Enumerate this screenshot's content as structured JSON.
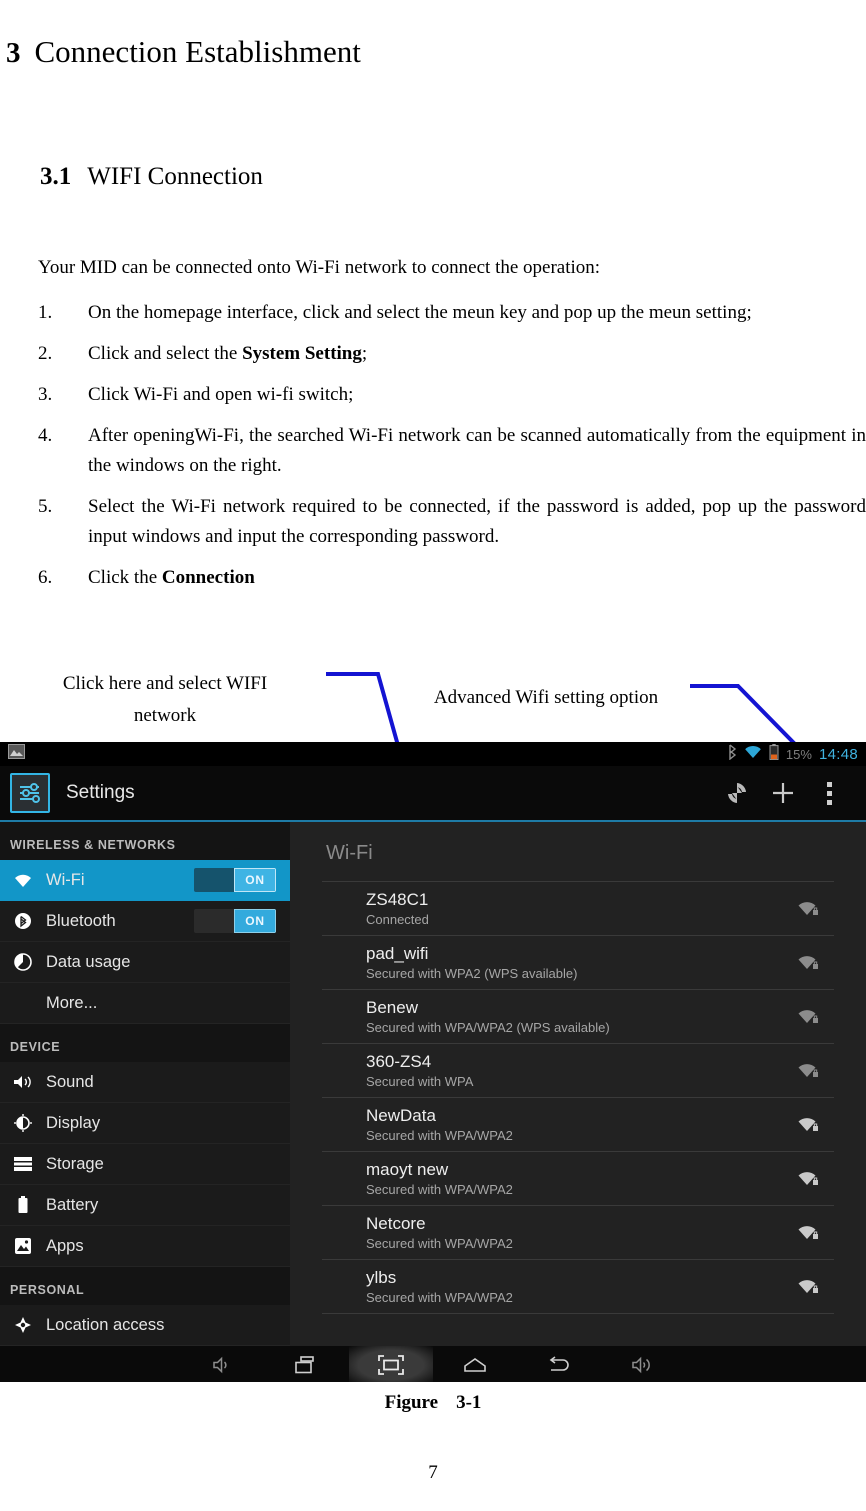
{
  "document": {
    "chapter": {
      "number": "3",
      "title": "Connection Establishment"
    },
    "section": {
      "number": "3.1",
      "title": "WIFI Connection"
    },
    "intro": "Your MID can be connected onto Wi-Fi network to connect the operation:",
    "steps": [
      {
        "marker": "1.",
        "text_before": "On the homepage interface, click and select the meun key and pop up the meun setting;",
        "bold": "",
        "text_after": ""
      },
      {
        "marker": "2.",
        "text_before": "Click and select the ",
        "bold": "System Setting",
        "text_after": ";"
      },
      {
        "marker": "3.",
        "text_before": "Click Wi-Fi and open wi-fi switch;",
        "bold": "",
        "text_after": ""
      },
      {
        "marker": "4.",
        "text_before": "After openingWi-Fi, the searched Wi-Fi network can be scanned automatically from the equipment in the windows on the right.",
        "bold": "",
        "text_after": ""
      },
      {
        "marker": "5.",
        "text_before": "Select the Wi-Fi network required to be connected, if the password is added, pop up the password input windows and input the corresponding password.",
        "bold": "",
        "text_after": ""
      },
      {
        "marker": "6.",
        "text_before": "Click the ",
        "bold": "Connection",
        "text_after": ""
      }
    ],
    "figure_caption": {
      "label": "Figure",
      "number": "3-1"
    },
    "page_number": "7"
  },
  "annotations": {
    "line_color": "#1414d2",
    "callout_wifi_network": "Click here and select WIFI network",
    "callout_advanced": "Advanced Wifi setting option"
  },
  "screenshot": {
    "statusbar": {
      "battery_percent": "15%",
      "clock": "14:48",
      "icons": [
        "image-icon",
        "bluetooth-icon",
        "wifi-icon",
        "battery-icon"
      ]
    },
    "actionbar": {
      "app_icon": "settings-sliders-icon",
      "title": "Settings",
      "actions": [
        "wifi-scan-icon",
        "add-network-icon",
        "overflow-menu-icon"
      ]
    },
    "sidebar": {
      "groups": [
        {
          "header": "WIRELESS & NETWORKS",
          "items": [
            {
              "icon": "wifi-icon",
              "label": "Wi-Fi",
              "toggle": "ON",
              "selected": true
            },
            {
              "icon": "bluetooth-icon",
              "label": "Bluetooth",
              "toggle": "ON",
              "selected": false
            },
            {
              "icon": "data-usage-icon",
              "label": "Data usage",
              "toggle": "",
              "selected": false
            },
            {
              "icon": "",
              "label": "More...",
              "toggle": "",
              "selected": false
            }
          ]
        },
        {
          "header": "DEVICE",
          "items": [
            {
              "icon": "sound-icon",
              "label": "Sound",
              "toggle": "",
              "selected": false
            },
            {
              "icon": "display-icon",
              "label": "Display",
              "toggle": "",
              "selected": false
            },
            {
              "icon": "storage-icon",
              "label": "Storage",
              "toggle": "",
              "selected": false
            },
            {
              "icon": "battery-icon",
              "label": "Battery",
              "toggle": "",
              "selected": false
            },
            {
              "icon": "apps-icon",
              "label": "Apps",
              "toggle": "",
              "selected": false
            }
          ]
        },
        {
          "header": "PERSONAL",
          "items": [
            {
              "icon": "location-icon",
              "label": "Location access",
              "toggle": "",
              "selected": false
            }
          ]
        }
      ]
    },
    "wifi_panel": {
      "title": "Wi-Fi",
      "networks": [
        {
          "name": "ZS48C1",
          "status": "Connected"
        },
        {
          "name": "pad_wifi",
          "status": "Secured with WPA2 (WPS available)"
        },
        {
          "name": "Benew",
          "status": "Secured with WPA/WPA2 (WPS available)"
        },
        {
          "name": "360-ZS4",
          "status": "Secured with WPA"
        },
        {
          "name": "NewData",
          "status": "Secured with WPA/WPA2"
        },
        {
          "name": "maoyt new",
          "status": "Secured with WPA/WPA2"
        },
        {
          "name": "Netcore",
          "status": "Secured with WPA/WPA2"
        },
        {
          "name": "ylbs",
          "status": "Secured with WPA/WPA2"
        }
      ]
    },
    "navbar": {
      "buttons": [
        "volume-down-icon",
        "recents-icon",
        "screenshot-icon",
        "home-icon",
        "back-icon",
        "volume-up-icon"
      ]
    },
    "colors": {
      "accent": "#33b5e5",
      "selected_row": "#1296c8",
      "clock": "#3fb2e0"
    }
  }
}
